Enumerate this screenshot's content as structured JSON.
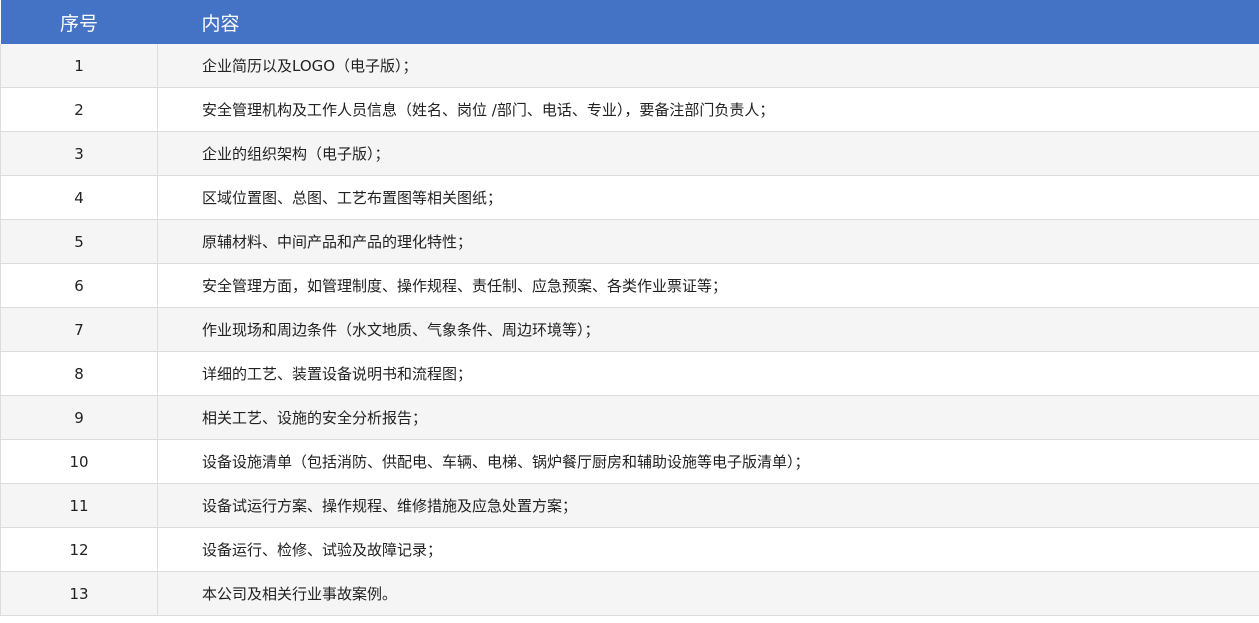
{
  "table": {
    "headers": {
      "number": "序号",
      "content": "内容"
    },
    "rows": [
      {
        "no": "1",
        "content": "企业简历以及LOGO（电子版）；"
      },
      {
        "no": "2",
        "content": "安全管理机构及工作人员信息（姓名、岗位 /部门、电话、专业），要备注部门负责人；"
      },
      {
        "no": "3",
        "content": "企业的组织架构（电子版）；"
      },
      {
        "no": "4",
        "content": "区域位置图、总图、工艺布置图等相关图纸；"
      },
      {
        "no": "5",
        "content": "原辅材料、中间产品和产品的理化特性；"
      },
      {
        "no": "6",
        "content": "安全管理方面，如管理制度、操作规程、责任制、应急预案、各类作业票证等；"
      },
      {
        "no": "7",
        "content": "作业现场和周边条件（水文地质、气象条件、周边环境等）；"
      },
      {
        "no": "8",
        "content": "详细的工艺、装置设备说明书和流程图；"
      },
      {
        "no": "9",
        "content": "相关工艺、设施的安全分析报告；"
      },
      {
        "no": "10",
        "content": "设备设施清单（包括消防、供配电、车辆、电梯、锅炉餐厅厨房和辅助设施等电子版清单）；"
      },
      {
        "no": "11",
        "content": "设备试运行方案、操作规程、维修措施及应急处置方案；"
      },
      {
        "no": "12",
        "content": "设备运行、检修、试验及故障记录；"
      },
      {
        "no": "13",
        "content": "本公司及相关行业事故案例。"
      }
    ]
  },
  "colors": {
    "header_bg": "#4472c4",
    "header_text": "#ffffff",
    "row_alt_bg": "#f5f5f5",
    "row_bg": "#ffffff",
    "border": "#dcdcdc"
  }
}
